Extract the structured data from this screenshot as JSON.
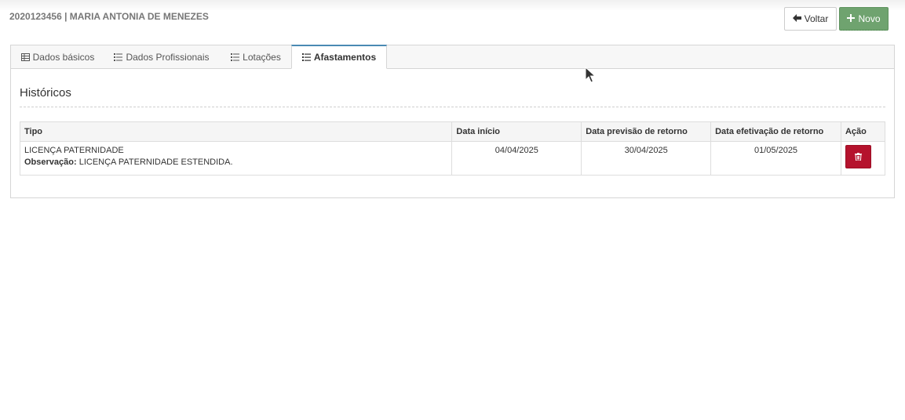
{
  "header": {
    "title": "2020123456 | MARIA ANTONIA DE MENEZES",
    "back_label": "Voltar",
    "new_label": "Novo"
  },
  "tabs": [
    {
      "label": "Dados básicos",
      "icon": "table-icon"
    },
    {
      "label": "Dados Profissionais",
      "icon": "list-icon"
    },
    {
      "label": "Lotações",
      "icon": "list-icon"
    },
    {
      "label": "Afastamentos",
      "icon": "list-ordered-icon",
      "active": true
    }
  ],
  "section": {
    "title": "Históricos"
  },
  "table": {
    "columns": [
      "Tipo",
      "Data início",
      "Data previsão de retorno",
      "Data efetivação de retorno",
      "Ação"
    ],
    "rows": [
      {
        "tipo": "LICENÇA PATERNIDADE",
        "obs_label": "Observação:",
        "obs_text": "LICENÇA PATERNIDADE ESTENDIDA.",
        "data_inicio": "04/04/2025",
        "data_previsao": "30/04/2025",
        "data_efetivacao": "01/05/2025",
        "action_icon": "trash-icon"
      }
    ]
  },
  "colors": {
    "novo_button": "#6fa36f",
    "delete_button": "#b5122d",
    "active_tab_accent": "#4a8ab3"
  }
}
